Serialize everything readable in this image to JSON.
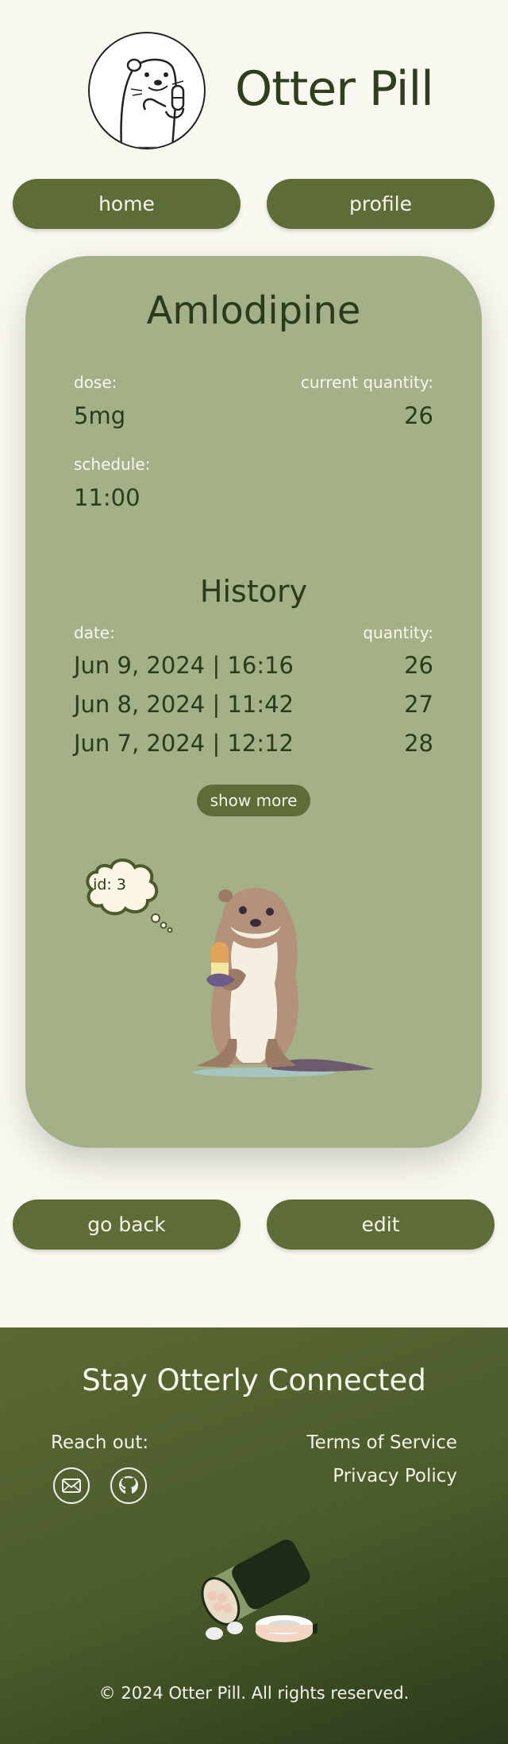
{
  "header": {
    "title": "Otter Pill"
  },
  "nav": {
    "home": "home",
    "profile": "profile"
  },
  "medication": {
    "name": "Amlodipine",
    "dose_label": "dose:",
    "dose": "5mg",
    "quantity_label": "current quantity:",
    "quantity": "26",
    "schedule_label": "schedule:",
    "schedule": "11:00"
  },
  "history": {
    "title": "History",
    "date_label": "date:",
    "quantity_label": "quantity:",
    "rows": [
      {
        "date": "Jun 9, 2024 | 16:16",
        "quantity": "26"
      },
      {
        "date": "Jun 8, 2024 | 11:42",
        "quantity": "27"
      },
      {
        "date": "Jun 7, 2024 | 12:12",
        "quantity": "28"
      }
    ],
    "show_more": "show more"
  },
  "mascot": {
    "bubble_text": "id: 3"
  },
  "actions": {
    "back": "go back",
    "edit": "edit"
  },
  "footer": {
    "title": "Stay Otterly Connected",
    "reach_out": "Reach out:",
    "terms": "Terms of Service",
    "privacy": "Privacy Policy",
    "copyright": "© 2024 Otter Pill. All rights reserved.",
    "icons": [
      "mail-icon",
      "github-icon"
    ]
  },
  "colors": {
    "background": "#f9f8f0",
    "card": "#a3b088",
    "button": "#5e6d37",
    "text_dark": "#2c3a1c",
    "footer_start": "#5a6833",
    "footer_end": "#2b3a1b"
  }
}
